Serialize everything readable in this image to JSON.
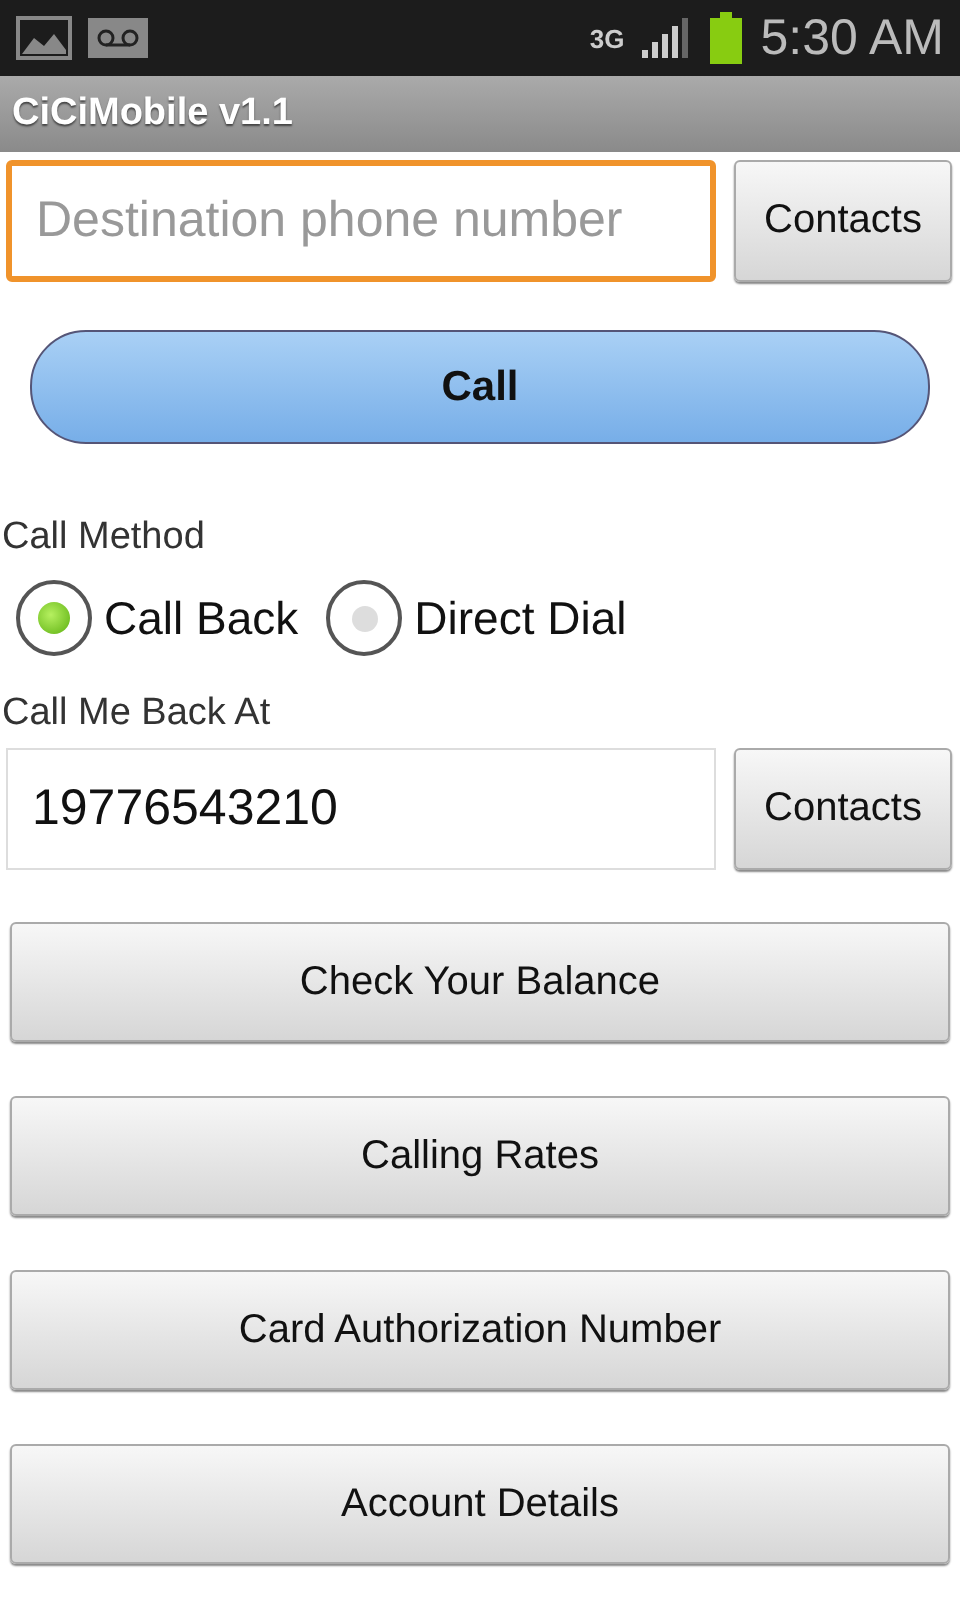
{
  "status_bar": {
    "network": "3G",
    "time": "5:30 AM"
  },
  "title_bar": {
    "title": "CiCiMobile v1.1"
  },
  "destination": {
    "placeholder": "Destination phone number",
    "focused": true,
    "contacts_button": "Contacts"
  },
  "call_button": "Call",
  "call_method": {
    "label": "Call Method",
    "options": [
      {
        "label": "Call Back",
        "selected": true
      },
      {
        "label": "Direct Dial",
        "selected": false
      }
    ]
  },
  "call_back": {
    "label": "Call Me Back At",
    "value": "19776543210",
    "contacts_button": "Contacts"
  },
  "buttons": [
    "Check Your Balance",
    "Calling Rates",
    "Card Authorization Number",
    "Account Details"
  ]
}
